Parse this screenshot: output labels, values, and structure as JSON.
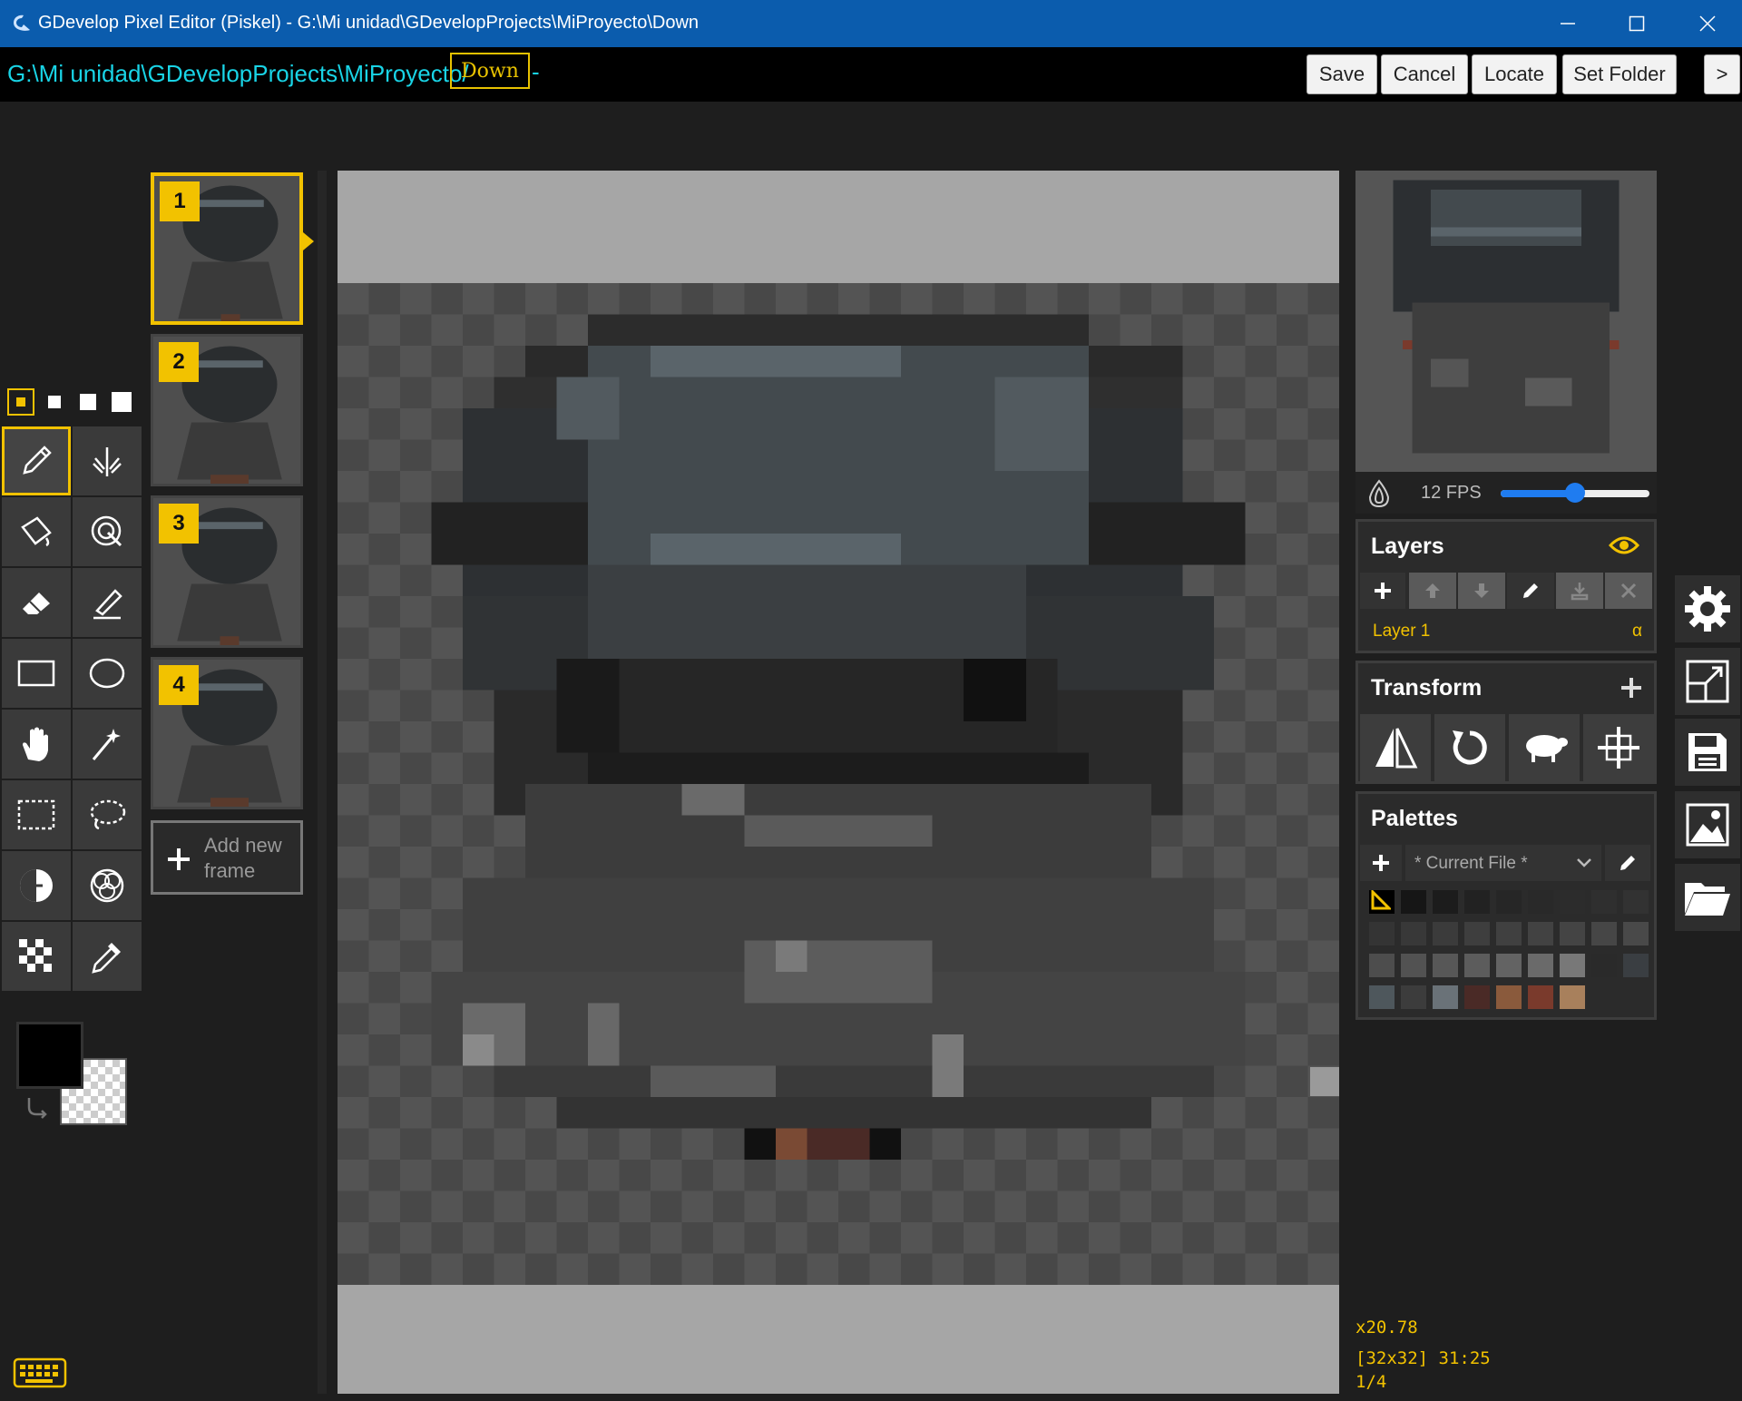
{
  "window": {
    "title": "GDevelop Pixel Editor (Piskel) - G:\\Mi unidad\\GDevelopProjects\\MiProyecto\\Down"
  },
  "pathbar": {
    "path": "G:\\Mi unidad\\GDevelopProjects\\MiProyecto/",
    "filename": "Down",
    "dash": "-",
    "buttons": {
      "save": "Save",
      "cancel": "Cancel",
      "locate": "Locate",
      "set_folder": "Set Folder",
      "more": ">"
    }
  },
  "frames": {
    "items": [
      {
        "number": "1"
      },
      {
        "number": "2"
      },
      {
        "number": "3"
      },
      {
        "number": "4"
      }
    ],
    "add_label_line1": "Add new",
    "add_label_line2": "frame"
  },
  "tools": {
    "pen_sizes": [
      "pen-size-1",
      "pen-size-2",
      "pen-size-3",
      "pen-size-4"
    ],
    "selected_tool": "pen-tool-icon",
    "primary_color": "#000000",
    "secondary_color": "transparent"
  },
  "preview": {
    "fps_label": "12 FPS",
    "fps_value": 12,
    "fps_slider_fraction": 0.5
  },
  "layers": {
    "title": "Layers",
    "items": [
      {
        "name": "Layer 1",
        "alpha_label": "α"
      }
    ]
  },
  "transform": {
    "title": "Transform"
  },
  "palettes": {
    "title": "Palettes",
    "selected": "* Current File *",
    "colors": [
      "#000000",
      "#161616",
      "#1c1c1c",
      "#222222",
      "#262626",
      "#292929",
      "#2c2c2c",
      "#2f2f2f",
      "#323232",
      "#343434",
      "#383838",
      "#3b3b3b",
      "#3e3e3e",
      "#404040",
      "#424242",
      "#444444",
      "#464646",
      "#494949",
      "#4d4d4d",
      "#525252",
      "#575757",
      "#5c5c5c",
      "#636363",
      "#6a6a6a",
      "#787878",
      "#2a2a2a",
      "#3a3e42",
      "#4e575c",
      "#3c3c3c",
      "#6a7278",
      "#4a2a26",
      "#8a5a3c",
      "#7a3a2c",
      "#a8805c"
    ]
  },
  "status": {
    "zoom": "x20.78",
    "size_and_cursor": "[32x32] 31:25",
    "frame_index": "1/4"
  },
  "colors": {
    "accent": "#f2c200",
    "path": "#19d4e6",
    "titlebar": "#0b5cad"
  }
}
